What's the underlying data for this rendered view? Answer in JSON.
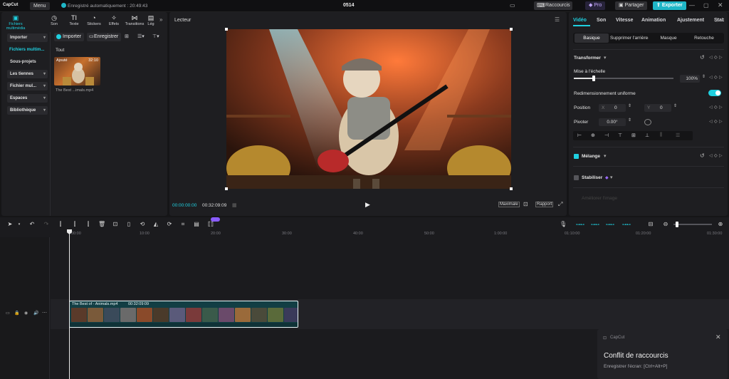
{
  "app": {
    "logo_text": "CapCut",
    "menu_label": "Menu",
    "autosave_text": "Enregistré automatiquement : 20:49:43",
    "project_name": "0514",
    "shortcuts_label": "Raccourcis",
    "pro_label": "Pro",
    "share_label": "Partager",
    "export_label": "Exporter"
  },
  "media_tabs": [
    {
      "label": "Fichiers multimédia",
      "icon": "media-icon"
    },
    {
      "label": "Son",
      "icon": "audio-icon"
    },
    {
      "label": "Texte",
      "icon": "text-icon"
    },
    {
      "label": "Stickers",
      "icon": "sticker-icon"
    },
    {
      "label": "Effets",
      "icon": "effects-icon"
    },
    {
      "label": "Transitions",
      "icon": "transition-icon"
    },
    {
      "label": "Lég",
      "icon": "caption-icon"
    }
  ],
  "sidebar": {
    "items": [
      {
        "label": "Importer"
      },
      {
        "label": "Fichiers multim..."
      },
      {
        "label": "Sous-projets"
      },
      {
        "label": "Les tiennes"
      },
      {
        "label": "Fichier mul..."
      },
      {
        "label": "Espaces"
      },
      {
        "label": "Bibliothèque"
      }
    ]
  },
  "media": {
    "import_button": "Importer",
    "record_button": "Enregistrer",
    "filter_all": "Tout",
    "thumb_badge": "Ajouté",
    "thumb_duration": "32:10",
    "thumb_name": "The Best ...imals.mp4"
  },
  "player": {
    "title": "Lecteur",
    "current_time": "00:00:00:00",
    "total_time": "00:32:09:09",
    "ratio_label": "Maximale",
    "aspect_label": "Rapport"
  },
  "props": {
    "tabs": [
      "Vidéo",
      "Son",
      "Vitesse",
      "Animation",
      "Ajustement",
      "Stab"
    ],
    "subtabs": [
      "Basique",
      "Supprimer l'arrière-plan",
      "Masque",
      "Retouche"
    ],
    "transform_label": "Transformer",
    "scale_label": "Mise à l'échelle",
    "scale_value": "100%",
    "scale_fraction": 0.2,
    "uniform_label": "Redimensionnement uniforme",
    "position_label": "Position",
    "x_label": "X",
    "x_value": "0",
    "y_label": "Y",
    "y_value": "0",
    "rotate_label": "Pivoter",
    "rotate_value": "0.00°",
    "blend_label": "Mélange",
    "stabilize_label": "Stabiliser",
    "more_label": "Améliorer l'image"
  },
  "timeline": {
    "ruler": [
      "00:00",
      "10:00",
      "20:00",
      "30:00",
      "40:00",
      "50:00",
      "1:00:00",
      "01:10:00",
      "01:20:00",
      "01:30:00"
    ],
    "clip_name": "The Best of - Animals.mp4",
    "clip_duration": "00:32:09:09",
    "zoom_fraction": 0.05
  },
  "toast": {
    "app": "CapCut",
    "title": "Conflit de raccourcis",
    "body": "Enregistrer l'écran: [Ctrl+Alt+P]"
  },
  "colors": {
    "accent": "#1fd0e0",
    "export": "#1fb6c7",
    "clip": "#123e44"
  }
}
